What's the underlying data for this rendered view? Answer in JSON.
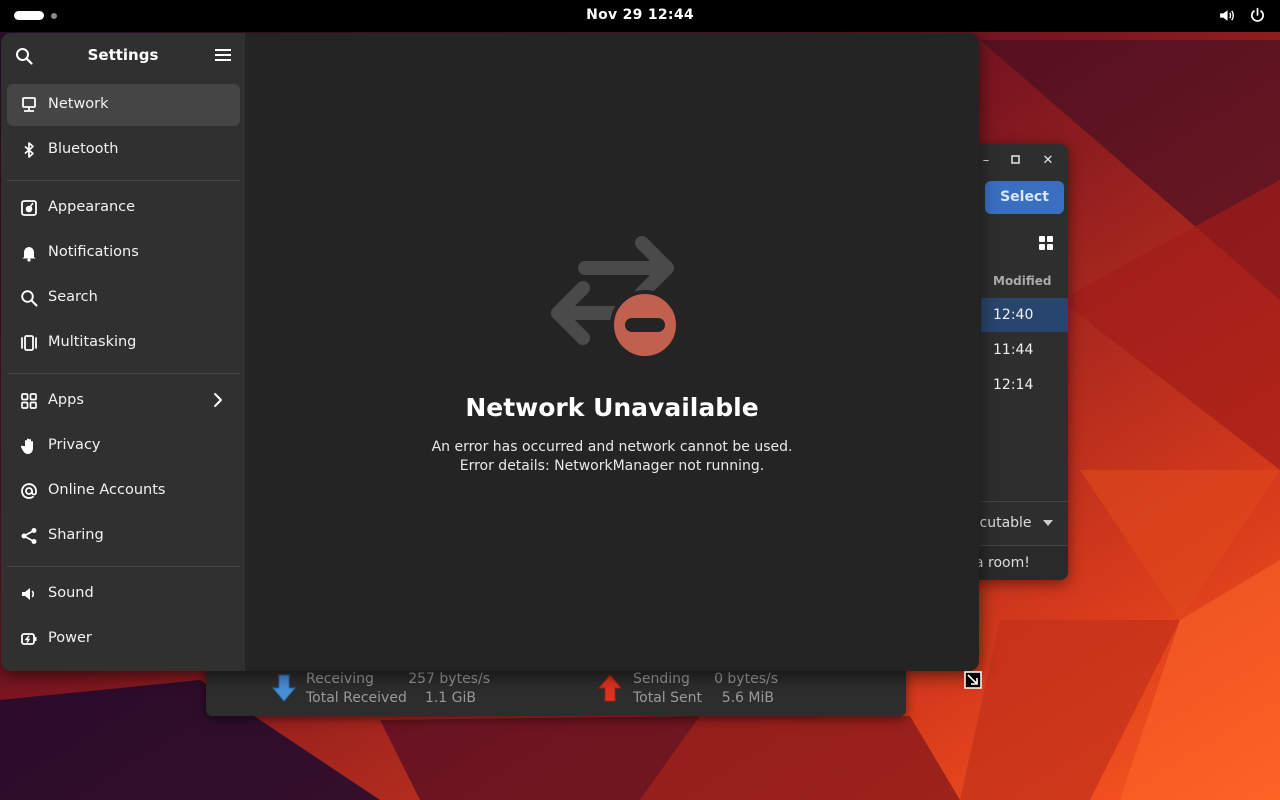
{
  "topbar": {
    "clock": "Nov 29  12:44",
    "icons": [
      "volume-icon",
      "power-icon"
    ]
  },
  "settings": {
    "title": "Settings",
    "sidebar": {
      "groups": [
        [
          {
            "label": "Network",
            "icon": "network-icon",
            "active": true
          },
          {
            "label": "Bluetooth",
            "icon": "bluetooth-icon"
          }
        ],
        [
          {
            "label": "Appearance",
            "icon": "appearance-icon"
          },
          {
            "label": "Notifications",
            "icon": "bell-icon"
          },
          {
            "label": "Search",
            "icon": "search-icon"
          },
          {
            "label": "Multitasking",
            "icon": "multitasking-icon"
          }
        ],
        [
          {
            "label": "Apps",
            "icon": "apps-icon",
            "has_submenu": true
          },
          {
            "label": "Privacy",
            "icon": "hand-icon"
          },
          {
            "label": "Online Accounts",
            "icon": "at-icon"
          },
          {
            "label": "Sharing",
            "icon": "share-icon"
          }
        ],
        [
          {
            "label": "Sound",
            "icon": "speaker-icon"
          },
          {
            "label": "Power",
            "icon": "power-plug-icon"
          }
        ]
      ]
    },
    "status": {
      "title": "Network Unavailable",
      "line1": "An error has occurred and network cannot be used.",
      "line2": "Error details: NetworkManager not running."
    }
  },
  "files_window": {
    "select_label": "Select",
    "column_modified": "Modified",
    "rows": [
      "12:40",
      "11:44",
      "12:14"
    ],
    "filter_label": "cutable",
    "footer_text": "a room!"
  },
  "network_monitor": {
    "receiving_label": "Receiving",
    "receiving_value": "257 bytes/s",
    "total_received_label": "Total Received",
    "total_received_value": "1.1 GiB",
    "sending_label": "Sending",
    "sending_value": "0 bytes/s",
    "total_sent_label": "Total Sent",
    "total_sent_value": "5.6 MiB"
  },
  "colors": {
    "accent": "#3a6fbf",
    "error": "#c0614f",
    "window_bg": "#242424",
    "sidebar_bg": "#303030"
  }
}
